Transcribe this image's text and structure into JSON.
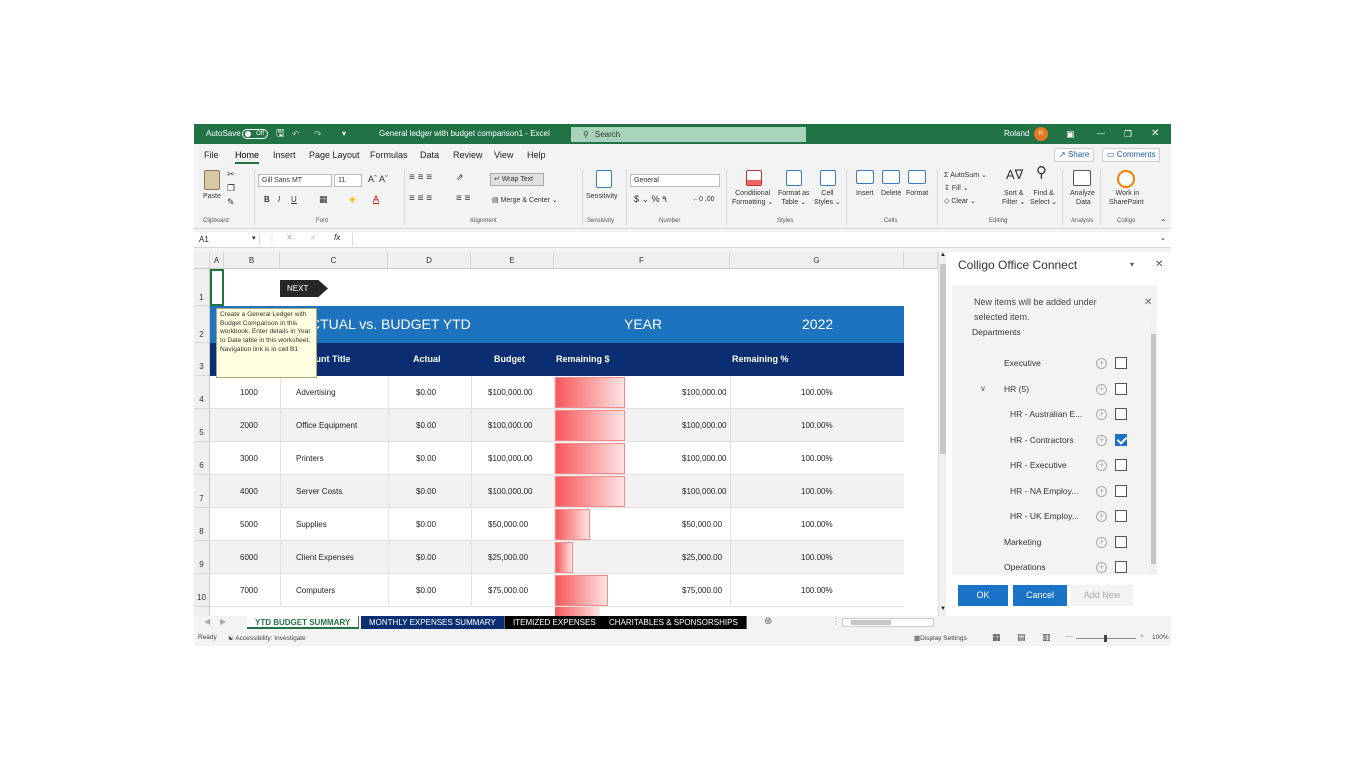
{
  "titlebar": {
    "autosave": "AutoSave",
    "autosave_state": "Off",
    "doc_title": "General ledger with budget comparison1  -  Excel",
    "search_placeholder": "Search",
    "user": "Roland",
    "avatar": "R"
  },
  "menu": {
    "items": [
      "File",
      "Home",
      "Insert",
      "Page Layout",
      "Formulas",
      "Data",
      "Review",
      "View",
      "Help"
    ],
    "active": "Home",
    "share": "Share",
    "comments": "Comments"
  },
  "ribbon": {
    "paste": "Paste",
    "font_name": "Gill Sans MT",
    "font_size": "11",
    "wrap_text": "Wrap Text",
    "merge_center": "Merge & Center",
    "sensitivity": "Sensitivity",
    "number_format": "General",
    "conditional": "Conditional",
    "formatting": "Formatting",
    "format_as": "Format as",
    "table": "Table",
    "cell": "Cell",
    "styles_lbl": "Styles",
    "insert": "Insert",
    "delete": "Delete",
    "format": "Format",
    "autosum": "AutoSum",
    "fill": "Fill",
    "clear": "Clear",
    "sort": "Sort &",
    "filter": "Filter",
    "find": "Find &",
    "select": "Select",
    "analyze": "Analyze",
    "data": "Data",
    "work_in": "Work in",
    "sharepoint": "SharePoint",
    "groups": {
      "clipboard": "Clipboard",
      "font": "Font",
      "alignment": "Alignment",
      "sensitivity": "Sensitivity",
      "number": "Number",
      "styles": "Styles",
      "cells": "Cells",
      "editing": "Editing",
      "analysis": "Analysis",
      "colligo": "Colligo"
    }
  },
  "formula": {
    "namebox": "A1",
    "fx": "fx"
  },
  "grid": {
    "columns": [
      "A",
      "B",
      "C",
      "D",
      "E",
      "F",
      "G"
    ],
    "rows": [
      "1",
      "2",
      "3",
      "4",
      "5",
      "6",
      "7",
      "8",
      "9",
      "10"
    ],
    "next_btn": "NEXT",
    "title": "CTUAL vs. BUDGET YTD",
    "year_label": "YEAR",
    "year_value": "2022",
    "headers": {
      "account_title": "ount Title",
      "actual": "Actual",
      "budget": "Budget",
      "remaining": "Remaining $",
      "remaining_pct": "Remaining %"
    },
    "tooltip": "Create a General Ledger with Budget Comparison in this workbook. Enter details in Year to Date table in this worksheet. Navigation link is in cell B1",
    "data": [
      {
        "acct": "1000",
        "title": "Advertising",
        "actual": "$0.00",
        "budget": "$100,000.00",
        "remaining": "$100,000.00",
        "pct": "100.00%",
        "bar": 1.0
      },
      {
        "acct": "2000",
        "title": "Office Equipment",
        "actual": "$0.00",
        "budget": "$100,000.00",
        "remaining": "$100,000.00",
        "pct": "100.00%",
        "bar": 1.0
      },
      {
        "acct": "3000",
        "title": "Printers",
        "actual": "$0.00",
        "budget": "$100,000.00",
        "remaining": "$100,000.00",
        "pct": "100.00%",
        "bar": 1.0
      },
      {
        "acct": "4000",
        "title": "Server Costs",
        "actual": "$0.00",
        "budget": "$100,000.00",
        "remaining": "$100,000.00",
        "pct": "100.00%",
        "bar": 1.0
      },
      {
        "acct": "5000",
        "title": "Supplies",
        "actual": "$0.00",
        "budget": "$50,000.00",
        "remaining": "$50,000.00",
        "pct": "100.00%",
        "bar": 0.5
      },
      {
        "acct": "6000",
        "title": "Client Expenses",
        "actual": "$0.00",
        "budget": "$25,000.00",
        "remaining": "$25,000.00",
        "pct": "100.00%",
        "bar": 0.25
      },
      {
        "acct": "7000",
        "title": "Computers",
        "actual": "$0.00",
        "budget": "$75,000.00",
        "remaining": "$75,000.00",
        "pct": "100.00%",
        "bar": 0.75
      }
    ]
  },
  "sheets": [
    "YTD BUDGET SUMMARY",
    "MONTHLY EXPENSES SUMMARY",
    "ITEMIZED EXPENSES",
    "CHARITABLES & SPONSORSHIPS"
  ],
  "status": {
    "ready": "Ready",
    "accessibility": "Accessibility: Investigate",
    "display": "Display Settings",
    "zoom": "100%"
  },
  "pane": {
    "title": "Colligo Office Connect",
    "info": "New items will be added under selected item.",
    "section": "Departments",
    "items": [
      {
        "label": "Executive",
        "checked": false
      },
      {
        "label": "HR (5)",
        "checked": false
      },
      {
        "label": "HR - Australian E...",
        "checked": false
      },
      {
        "label": "HR - Contractors",
        "checked": true
      },
      {
        "label": "HR - Executive",
        "checked": false
      },
      {
        "label": "HR - NA Employ...",
        "checked": false
      },
      {
        "label": "HR - UK Employ...",
        "checked": false
      },
      {
        "label": "Marketing",
        "checked": false
      },
      {
        "label": "Operations",
        "checked": false
      }
    ],
    "ok": "OK",
    "cancel": "Cancel",
    "add_new": "Add New"
  }
}
